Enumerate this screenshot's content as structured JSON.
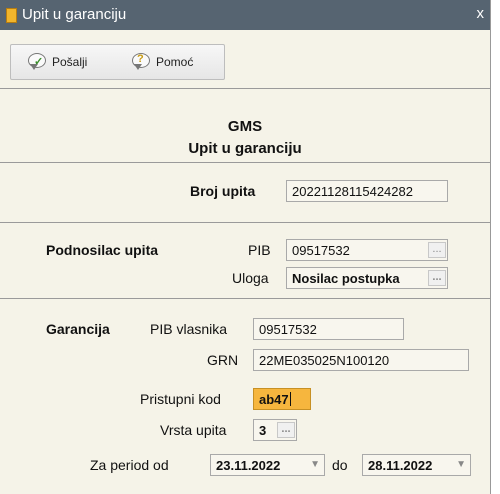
{
  "window": {
    "title": "Upit u garanciju",
    "close": "x"
  },
  "toolbar": {
    "send_label": "Pošalji",
    "help_label": "Pomoć"
  },
  "header": {
    "line1": "GMS",
    "line2": "Upit u garanciju"
  },
  "broj_upita": {
    "label": "Broj upita",
    "value": "20221128115424282"
  },
  "podnosilac": {
    "section_label": "Podnosilac upita",
    "pib_label": "PIB",
    "pib_value": "09517532",
    "uloga_label": "Uloga",
    "uloga_value": "Nosilac postupka",
    "browse": "..."
  },
  "garancija": {
    "section_label": "Garancija",
    "pib_vlasnika_label": "PIB vlasnika",
    "pib_vlasnika_value": "09517532",
    "grn_label": "GRN",
    "grn_value": "22ME035025N100120",
    "pristupni_kod_label": "Pristupni kod",
    "pristupni_kod_value": "ab47",
    "vrsta_upita_label": "Vrsta upita",
    "vrsta_upita_value": "3",
    "period_label": "Za period od",
    "period_from": "23.11.2022",
    "period_to_label": "do",
    "period_to": "28.11.2022"
  }
}
